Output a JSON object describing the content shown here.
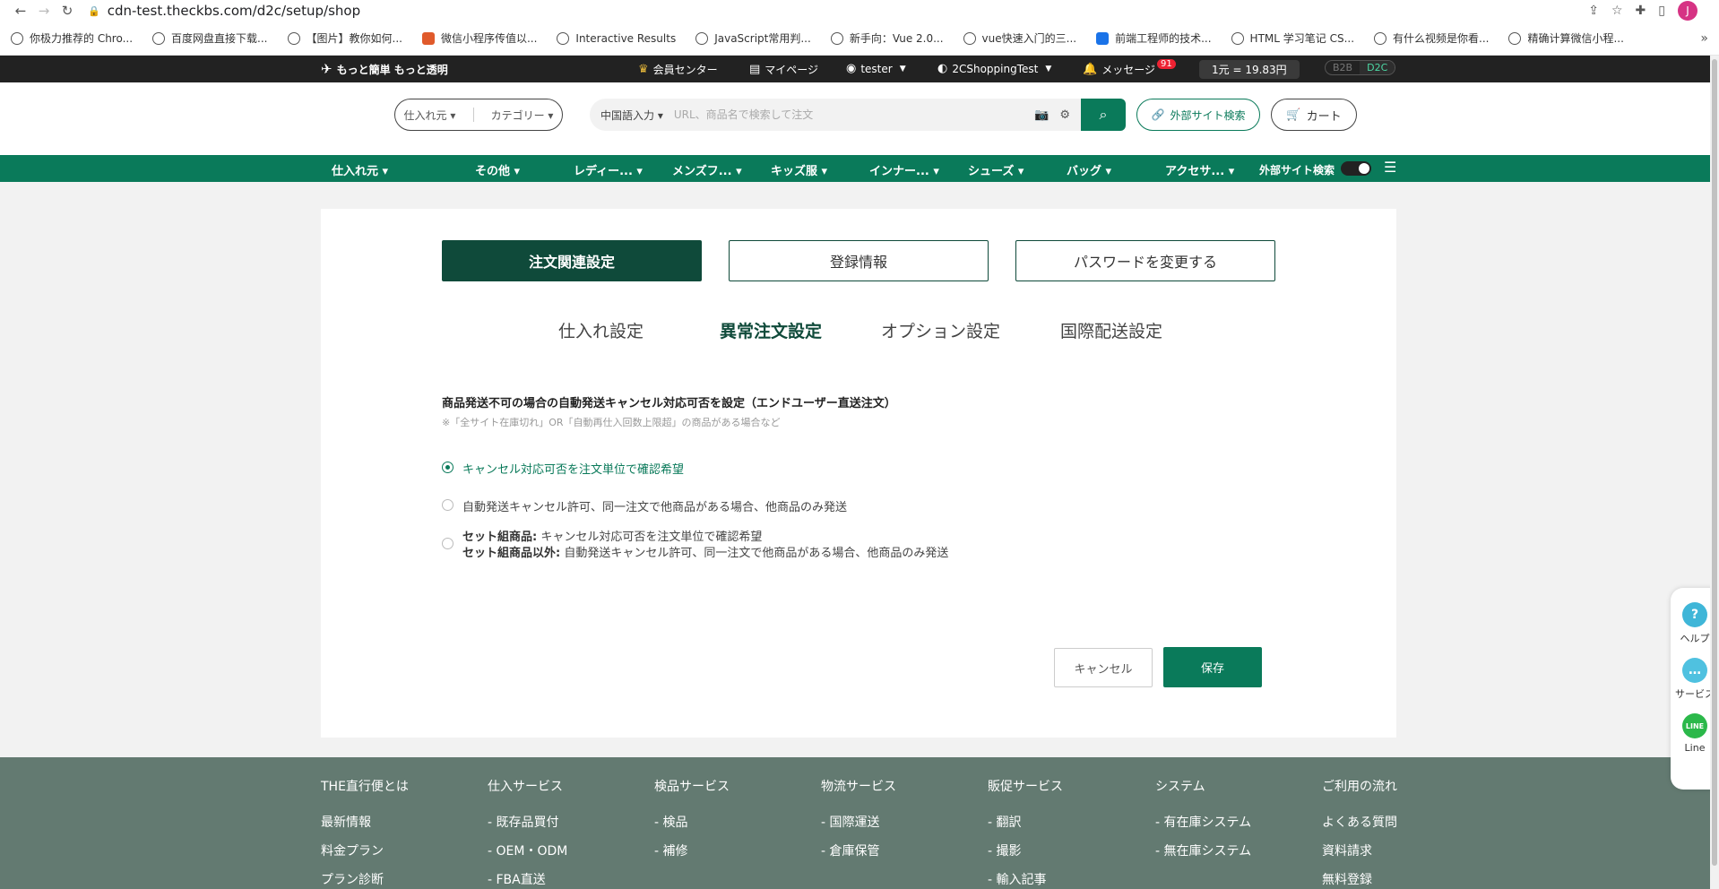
{
  "browser": {
    "url": "cdn-test.theckbs.com/d2c/setup/shop",
    "profile_initial": "J"
  },
  "bookmarks": [
    {
      "label": "你极力推荐的 Chro...",
      "icon": "globe"
    },
    {
      "label": "百度网盘直接下载...",
      "icon": "globe"
    },
    {
      "label": "【图片】教你如何...",
      "icon": "globe"
    },
    {
      "label": "微信小程序传值以...",
      "icon": "red"
    },
    {
      "label": "Interactive Results",
      "icon": "globe"
    },
    {
      "label": "JavaScript常用判...",
      "icon": "globe"
    },
    {
      "label": "新手向：Vue 2.0...",
      "icon": "globe"
    },
    {
      "label": "vue快速入门的三...",
      "icon": "globe"
    },
    {
      "label": "前端工程师的技术...",
      "icon": "blue"
    },
    {
      "label": "HTML 学习笔记 CS...",
      "icon": "globe"
    },
    {
      "label": "有什么视频是你看...",
      "icon": "globe"
    },
    {
      "label": "精确计算微信小程...",
      "icon": "globe"
    }
  ],
  "topbar": {
    "logo": "もっと簡単 もっと透明",
    "member_center": "会員センター",
    "mypage": "マイページ",
    "user": "tester",
    "shop": "2CShoppingTest",
    "messages": "メッセージ",
    "message_count": "91",
    "rate": "1元 = 19.83円",
    "mode_b2b": "B2B",
    "mode_d2c": "D2C"
  },
  "header": {
    "supplier": "仕入れ元",
    "category": "カテゴリー",
    "search_lang": "中国語入力",
    "search_placeholder": "URL、商品名で検索して注文",
    "external_search": "外部サイト検索",
    "cart": "カート"
  },
  "catnav": {
    "items": [
      "仕入れ元",
      "その他",
      "レディー...",
      "メンズフ...",
      "キッズ服",
      "インナー...",
      "シューズ",
      "バッグ",
      "アクセサ..."
    ],
    "external_label": "外部サイト検索"
  },
  "tabs": [
    "注文関連設定",
    "登録情報",
    "パスワードを変更する"
  ],
  "subtabs": [
    "仕入れ設定",
    "異常注文設定",
    "オプション設定",
    "国際配送設定"
  ],
  "section": {
    "title": "商品発送不可の場合の自動発送キャンセル対応可否を設定（エンドユーザー直送注文）",
    "note": "※「全サイト在庫切れ」OR「自動再仕入回数上限超」の商品がある場合など",
    "options": [
      {
        "text": "キャンセル対応可否を注文単位で確認希望"
      },
      {
        "text": "自動発送キャンセル許可、同一注文で他商品がある場合、他商品のみ発送"
      },
      {
        "set_label": "セット組商品:",
        "set_text": "キャンセル対応可否を注文単位で確認希望",
        "nonset_label": "セット組商品以外:",
        "nonset_text": "自動発送キャンセル許可、同一注文で他商品がある場合、他商品のみ発送"
      }
    ]
  },
  "buttons": {
    "cancel": "キャンセル",
    "save": "保存"
  },
  "footer": {
    "columns": [
      {
        "heading": "THE直行便とは",
        "links": [
          "最新情報",
          "料金プラン",
          "プラン診断"
        ]
      },
      {
        "heading": "仕入サービス",
        "links": [
          "- 既存品買付",
          "- OEM・ODM",
          "- FBA直送"
        ]
      },
      {
        "heading": "検品サービス",
        "links": [
          "- 検品",
          "- 補修"
        ]
      },
      {
        "heading": "物流サービス",
        "links": [
          "- 国際運送",
          "- 倉庫保管"
        ]
      },
      {
        "heading": "販促サービス",
        "links": [
          "- 翻訳",
          "- 撮影",
          "- 輸入記事"
        ]
      },
      {
        "heading": "システム",
        "links": [
          "- 有在庫システム",
          "- 無在庫システム"
        ]
      },
      {
        "heading": "ご利用の流れ",
        "links": [
          "よくある質問",
          "資料請求",
          "無料登録"
        ]
      }
    ]
  },
  "side_widget": {
    "help": "ヘルプ",
    "service": "サービス",
    "line": "Line",
    "line_badge": "LINE"
  },
  "colors": {
    "brand_green": "#0a7a5a",
    "dark_green": "#0f4a3a",
    "footer": "#637a71"
  }
}
